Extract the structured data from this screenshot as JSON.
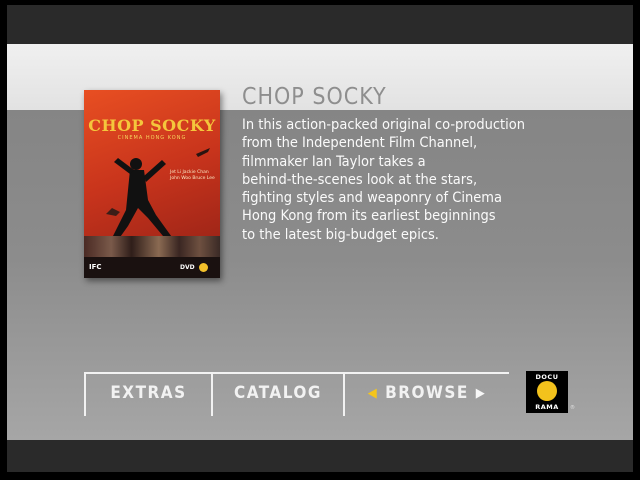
{
  "title": "CHOP SOCKY",
  "description": "In this action-packed original co-production\nfrom the Independent Film Channel,\nfilmmaker Ian Taylor takes a\nbehind-the-scenes look at the stars,\nfighting styles and weaponry of Cinema\nHong Kong from its earliest beginnings\nto the latest big-budget epics.",
  "cover": {
    "title": "CHOP SOCKY",
    "subtitle": "CINEMA HONG KONG",
    "credits": "Jet Li Jackie Chan John Woo Bruce Lee",
    "network": "IFC",
    "format": "DVD"
  },
  "nav": {
    "extras": "EXTRAS",
    "catalog": "CATALOG",
    "browse": "BROWSE",
    "browse_left_arrow": "◀",
    "browse_right_arrow": "▶"
  },
  "brand": {
    "top": "DOCU",
    "bottom": "RAMA",
    "reg": "®"
  },
  "colors": {
    "accent": "#f4c51c",
    "panel": "#8a8a8a",
    "band": "#e8e8e8"
  }
}
